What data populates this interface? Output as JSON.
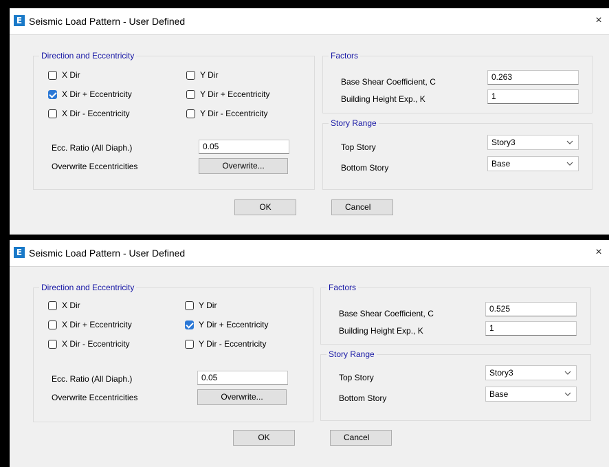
{
  "dialogs": [
    {
      "title": "Seismic Load Pattern - User Defined",
      "close": "×",
      "direction": {
        "title": "Direction and Eccentricity",
        "items": [
          {
            "label": "X Dir",
            "checked": false
          },
          {
            "label": "X Dir + Eccentricity",
            "checked": true
          },
          {
            "label": "X Dir - Eccentricity",
            "checked": false
          },
          {
            "label": "Y Dir",
            "checked": false
          },
          {
            "label": "Y Dir + Eccentricity",
            "checked": false
          },
          {
            "label": "Y Dir - Eccentricity",
            "checked": false
          }
        ],
        "ecc_ratio_label": "Ecc. Ratio (All Diaph.)",
        "ecc_ratio_value": "0.05",
        "overwrite_label": "Overwrite Eccentricities",
        "overwrite_button": "Overwrite..."
      },
      "factors": {
        "title": "Factors",
        "base_shear_label": "Base Shear Coefficient, C",
        "base_shear_value": "0.263",
        "height_exp_label": "Building Height Exp., K",
        "height_exp_value": "1"
      },
      "story_range": {
        "title": "Story Range",
        "top_label": "Top Story",
        "top_value": "Story3",
        "bottom_label": "Bottom Story",
        "bottom_value": "Base"
      },
      "ok": "OK",
      "cancel": "Cancel"
    },
    {
      "title": "Seismic Load Pattern - User Defined",
      "close": "×",
      "direction": {
        "title": "Direction and Eccentricity",
        "items": [
          {
            "label": "X Dir",
            "checked": false
          },
          {
            "label": "X Dir + Eccentricity",
            "checked": false
          },
          {
            "label": "X Dir - Eccentricity",
            "checked": false
          },
          {
            "label": "Y Dir",
            "checked": false
          },
          {
            "label": "Y Dir + Eccentricity",
            "checked": true
          },
          {
            "label": "Y Dir - Eccentricity",
            "checked": false
          }
        ],
        "ecc_ratio_label": "Ecc. Ratio (All Diaph.)",
        "ecc_ratio_value": "0.05",
        "overwrite_label": "Overwrite Eccentricities",
        "overwrite_button": "Overwrite..."
      },
      "factors": {
        "title": "Factors",
        "base_shear_label": "Base Shear Coefficient, C",
        "base_shear_value": "0.525",
        "height_exp_label": "Building Height Exp., K",
        "height_exp_value": "1"
      },
      "story_range": {
        "title": "Story Range",
        "top_label": "Top Story",
        "top_value": "Story3",
        "bottom_label": "Bottom Story",
        "bottom_value": "Base"
      },
      "ok": "OK",
      "cancel": "Cancel"
    }
  ]
}
